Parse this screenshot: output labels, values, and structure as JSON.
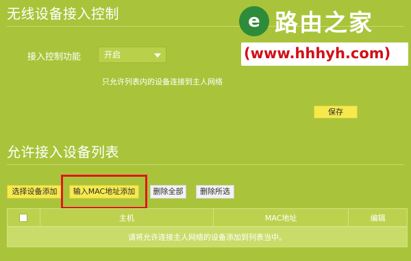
{
  "access_control": {
    "title": "无线设备接入控制",
    "function_label": "接入控制功能",
    "function_value": "开启",
    "hint": "只允许列表内的设备连接到主人网络",
    "save_label": "保存"
  },
  "allow_list": {
    "title": "允许接入设备列表",
    "buttons": {
      "select_add": "选择设备添加",
      "mac_add": "输入MAC地址添加",
      "delete_all": "删除全部",
      "delete_selected": "删除所选"
    },
    "table": {
      "headers": [
        "",
        "主机",
        "MAC地址",
        "编辑"
      ],
      "empty_message": "请将允许连接主人网络的设备添加到列表当中。"
    }
  },
  "watermark": {
    "logo_letter": "e",
    "brand": "路由之家",
    "url": "(www.hhhyh.com)"
  },
  "colors": {
    "background": "#a9c43a",
    "button_yellow": "#f5e94e",
    "highlight_red": "#e3151b",
    "logo_green": "#2e8b3a",
    "url_red": "#d10f17"
  }
}
